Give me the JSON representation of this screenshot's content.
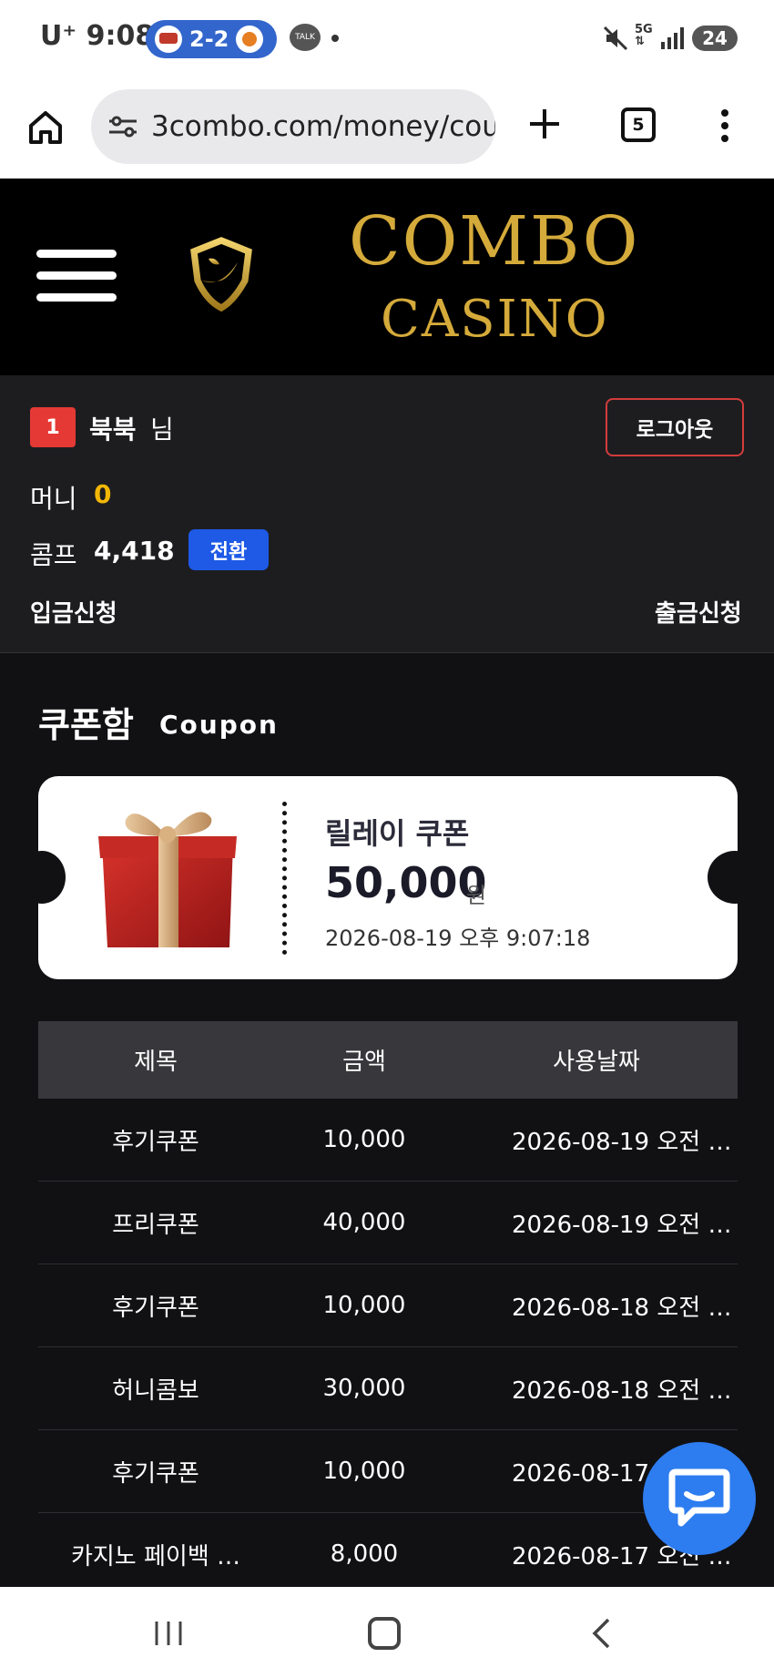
{
  "status_bar": {
    "carrier_time": "U⁺ 9:08",
    "score": "2-2",
    "talk": "TALK",
    "network": "5G",
    "battery": "24"
  },
  "browser": {
    "url": "3combo.com/money/cou",
    "tab_count": "5"
  },
  "header": {
    "logo_line_1": "COMBO",
    "logo_line_2": "CASINO"
  },
  "user": {
    "level": "1",
    "name": "북북",
    "honorific": "님",
    "logout_label": "로그아웃",
    "money_label": "머니",
    "money_value": "0",
    "comp_label": "콤프",
    "comp_value": "4,418",
    "convert_label": "전환",
    "deposit_label": "입금신청",
    "withdraw_label": "출금신청"
  },
  "section": {
    "title": "쿠폰함",
    "subtitle": "Coupon"
  },
  "coupon": {
    "name": "릴레이 쿠폰",
    "amount": "50,000",
    "unit": "원",
    "date": "2026-08-19 오후 9:07:18"
  },
  "table": {
    "headers": [
      "제목",
      "금액",
      "사용날짜"
    ],
    "rows": [
      {
        "title": "후기쿠폰",
        "amount": "10,000",
        "date": "2026-08-19 오전 …"
      },
      {
        "title": "프리쿠폰",
        "amount": "40,000",
        "date": "2026-08-19 오전 …"
      },
      {
        "title": "후기쿠폰",
        "amount": "10,000",
        "date": "2026-08-18 오전 …"
      },
      {
        "title": "허니콤보",
        "amount": "30,000",
        "date": "2026-08-18 오전 …"
      },
      {
        "title": "후기쿠폰",
        "amount": "10,000",
        "date": "2026-08-17 오전 …"
      },
      {
        "title": "카지노 페이백 …",
        "amount": "8,000",
        "date": "2026-08-17 오전 …"
      }
    ]
  },
  "colors": {
    "accent_blue": "#1e5ae6",
    "money_gold": "#f2b705",
    "logout_border": "#d33c3c",
    "logo_gold": "#d4aa3a",
    "chat_blue": "#2d7cf0"
  }
}
